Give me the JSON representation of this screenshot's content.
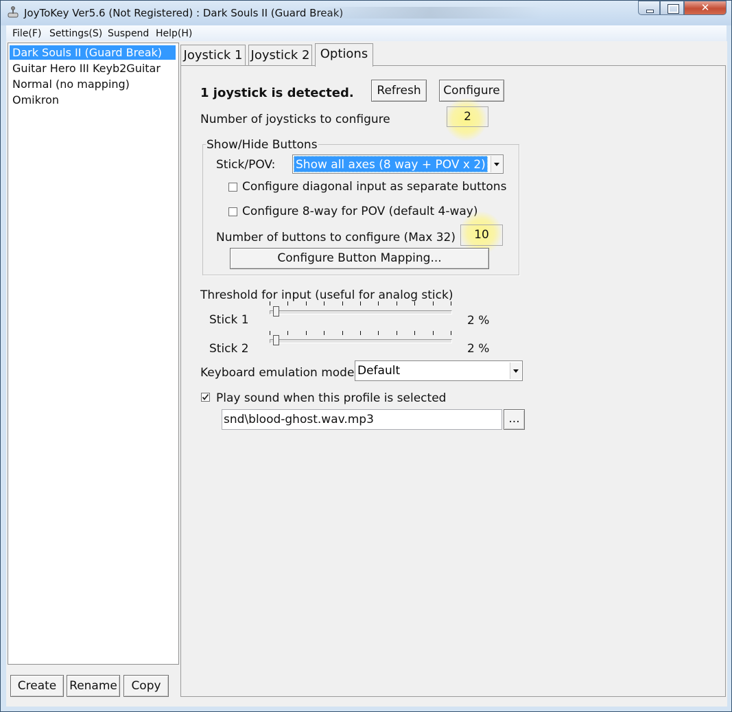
{
  "window": {
    "title": "JoyToKey Ver5.6 (Not Registered) : Dark Souls II (Guard Break)"
  },
  "menu": [
    "File(F)",
    "Settings(S)",
    "Suspend",
    "Help(H)"
  ],
  "profiles": [
    {
      "label": "Dark Souls II (Guard Break)",
      "selected": true
    },
    {
      "label": "Guitar Hero III Keyb2Guitar",
      "selected": false
    },
    {
      "label": "Normal (no mapping)",
      "selected": false
    },
    {
      "label": "Omikron",
      "selected": false
    }
  ],
  "profile_buttons": [
    "Create",
    "Rename",
    "Copy"
  ],
  "tabs": [
    {
      "label": "Joystick 1",
      "active": false
    },
    {
      "label": "Joystick 2",
      "active": false
    },
    {
      "label": "Options",
      "active": true
    }
  ],
  "options": {
    "detected_text": "1 joystick is detected.",
    "refresh_label": "Refresh",
    "configure_label": "Configure",
    "num_joysticks_label": "Number of joysticks to configure",
    "num_joysticks_value": "2",
    "group_title": "Show/Hide Buttons",
    "stick_pov_label": "Stick/POV:",
    "stick_pov_value": "Show all axes (8 way + POV x 2)",
    "diagonal_label": "Configure diagonal input as separate buttons",
    "diagonal_checked": false,
    "pov8_label": "Configure 8-way for POV (default 4-way)",
    "pov8_checked": false,
    "num_buttons_label": "Number of buttons to configure (Max 32)",
    "num_buttons_value": "10",
    "button_mapping_label": "Configure Button Mapping...",
    "threshold_label": "Threshold for input (useful for analog stick)",
    "stick1_label": "Stick 1",
    "stick1_percent": 2,
    "stick1_value": "2 %",
    "stick2_label": "Stick 2",
    "stick2_percent": 2,
    "stick2_value": "2 %",
    "keyboard_mode_label": "Keyboard emulation mode",
    "keyboard_mode_value": "Default",
    "play_sound_label": "Play sound when this profile is selected",
    "play_sound_checked": true,
    "sound_file": "snd\\blood-ghost.wav.mp3",
    "browse_label": "..."
  },
  "colors": {
    "selection": "#3399ff",
    "highlight": "#fff37a",
    "close_button": "#c44f36"
  }
}
